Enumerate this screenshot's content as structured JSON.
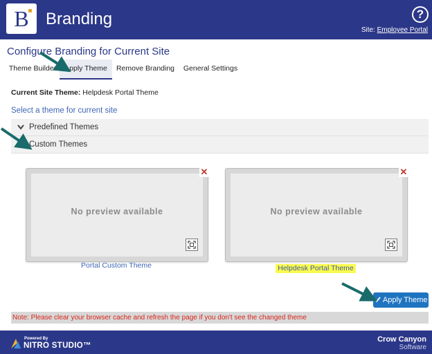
{
  "header": {
    "logo_letter": "B",
    "title": "Branding",
    "help_icon_glyph": "?",
    "site_label": "Site:",
    "site_name": "Employee Portal"
  },
  "page": {
    "title": "Configure Branding for Current Site"
  },
  "tabs": [
    {
      "label": "Theme Builder",
      "active": false
    },
    {
      "label": "Apply Theme",
      "active": true
    },
    {
      "label": "Remove Branding",
      "active": false
    },
    {
      "label": "General Settings",
      "active": false
    }
  ],
  "current_theme": {
    "label": "Current Site Theme:",
    "value": "Helpdesk Portal Theme"
  },
  "select_hint": "Select a theme for current site",
  "accordions": [
    {
      "label": "Predefined Themes",
      "icon": "chevron-down-icon"
    },
    {
      "label": "Custom Themes",
      "icon": "close-icon"
    }
  ],
  "themes": [
    {
      "label": "Portal Custom Theme",
      "preview_text": "No preview available",
      "highlighted": false
    },
    {
      "label": "Helpdesk Portal Theme",
      "preview_text": "No preview available",
      "highlighted": true
    }
  ],
  "apply_button": {
    "label": "Apply Theme"
  },
  "note": "Note: Please clear your browser cache and refresh the page if you don't see the changed theme",
  "footer": {
    "powered_by": "Powered By",
    "product": "NITRO STUDIO™",
    "company_line1": "Crow Canyon",
    "company_line2": "Software"
  },
  "colors": {
    "brand": "#2b3788",
    "link": "#3f66b5",
    "button": "#1f74c0",
    "note_text": "#d9261c",
    "highlight": "#fbfb4f",
    "annotation_arrow": "#1a6b6b"
  }
}
